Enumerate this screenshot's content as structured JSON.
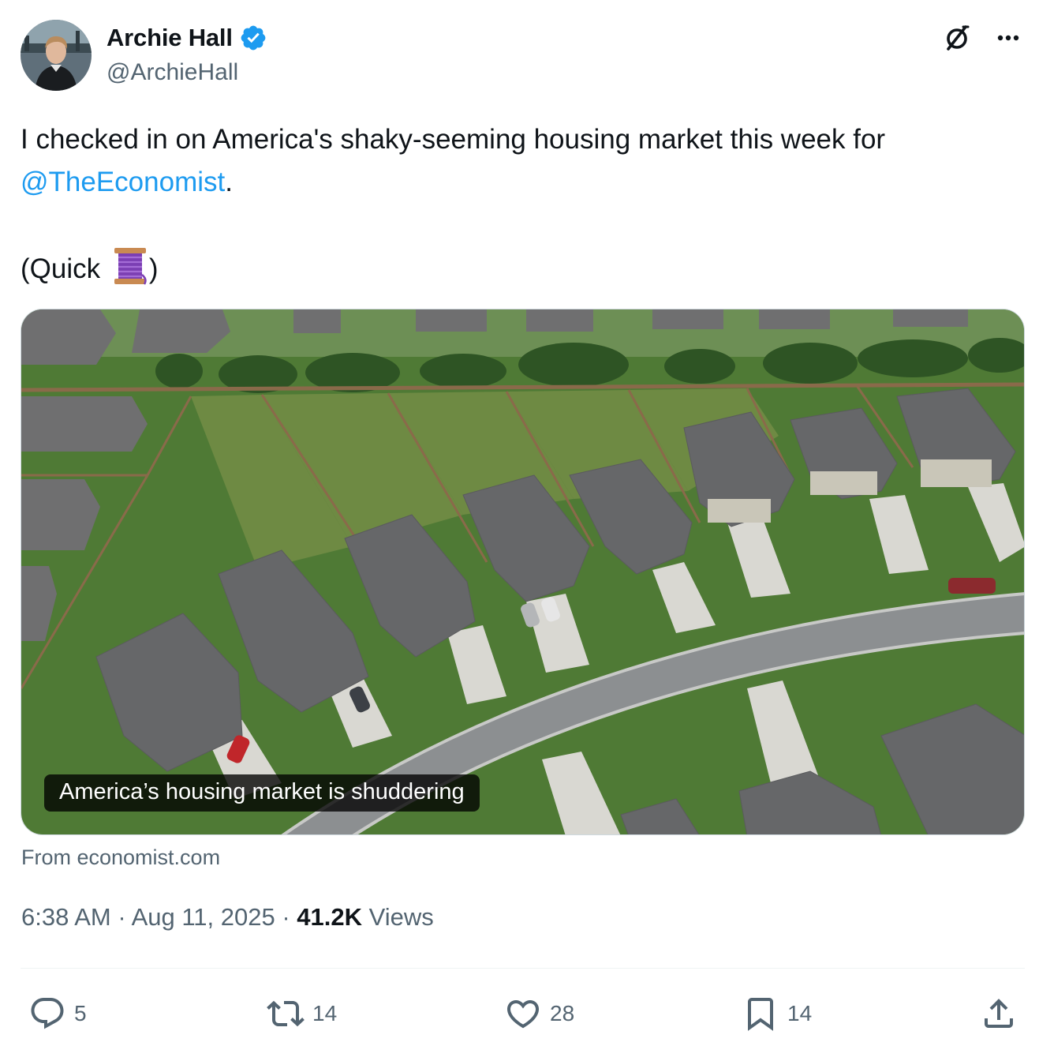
{
  "author": {
    "display_name": "Archie Hall",
    "handle": "@ArchieHall",
    "verified": true,
    "avatar": "profile-photo"
  },
  "header_actions": {
    "grok_icon": "grok-icon",
    "more_icon": "more-icon"
  },
  "tweet": {
    "text_line1": "I checked in on America's shaky-seeming housing market this week for",
    "mention": "@TheEconomist",
    "text_after_mention": ".",
    "quick_open": "(Quick ",
    "quick_emoji": "thread-spool-emoji",
    "quick_close": ")"
  },
  "link_card": {
    "image": "aerial-suburban-houses",
    "caption": "America’s housing market is shuddering",
    "source": "From economist.com"
  },
  "meta": {
    "time": "6:38 AM",
    "separator": " · ",
    "date": "Aug 11, 2025",
    "views_count": "41.2K",
    "views_label": " Views"
  },
  "actions": {
    "replies": "5",
    "reposts": "14",
    "likes": "28",
    "bookmarks": "14"
  },
  "colors": {
    "accent": "#1d9bf0",
    "text": "#0f1419",
    "secondary": "#536471"
  }
}
